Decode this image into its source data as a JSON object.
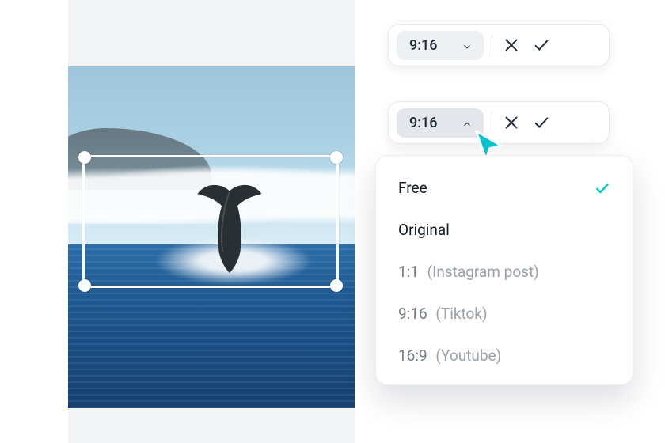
{
  "colors": {
    "accent": "#00c8c8",
    "text": "#1f2937",
    "muted": "#9aa1a9",
    "chip_bg": "#eef1f4"
  },
  "badge1": {
    "ratio": "9:16"
  },
  "badge2": {
    "ratio": "9:16"
  },
  "dropdown": {
    "selected_index": 0,
    "items": [
      {
        "label": "Free",
        "sub": "",
        "muted": false,
        "selected": true
      },
      {
        "label": "Original",
        "sub": "",
        "muted": false,
        "selected": false
      },
      {
        "label": "1:1",
        "sub": "(Instagram post)",
        "muted": true,
        "selected": false
      },
      {
        "label": "9:16",
        "sub": "(Tiktok)",
        "muted": true,
        "selected": false
      },
      {
        "label": "16:9",
        "sub": "(Youtube)",
        "muted": true,
        "selected": false
      }
    ]
  }
}
